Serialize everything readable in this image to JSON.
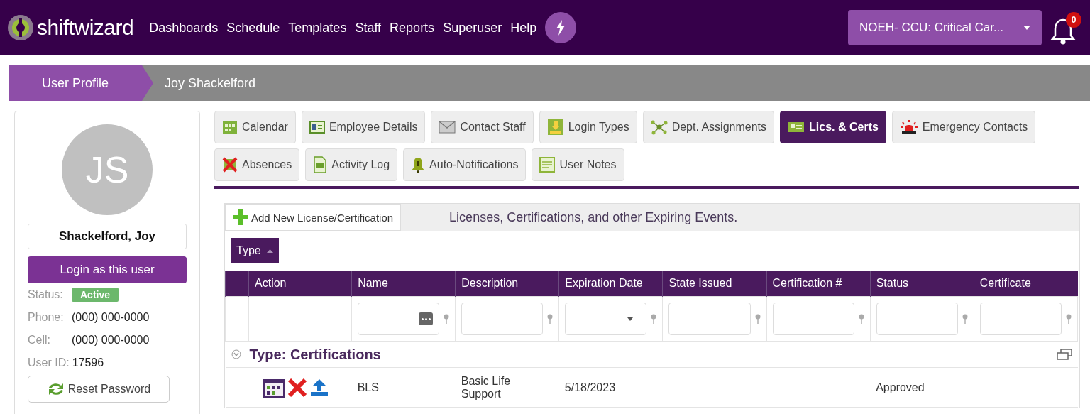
{
  "header": {
    "logo": "shiftwizard",
    "nav": [
      "Dashboards",
      "Schedule",
      "Templates",
      "Staff",
      "Reports",
      "Superuser",
      "Help"
    ],
    "department": "NOEH- CCU: Critical Car...",
    "notifications": "0"
  },
  "breadcrumb": [
    "User Profile",
    "Joy Shackelford"
  ],
  "profile": {
    "initials": "JS",
    "name": "Shackelford, Joy",
    "login_button": "Login as this user",
    "fields": [
      {
        "label": "Status:",
        "value": "Active",
        "kind": "badge"
      },
      {
        "label": "Phone:",
        "value": "(000) 000-0000",
        "kind": "text"
      },
      {
        "label": "Cell:",
        "value": "(000) 000-0000",
        "kind": "text"
      },
      {
        "label": "User ID:",
        "value": "17596",
        "kind": "text"
      }
    ],
    "reset_button": "Reset Password"
  },
  "tabs": [
    {
      "label": "Calendar",
      "selected": false
    },
    {
      "label": "Employee Details",
      "selected": false
    },
    {
      "label": "Contact Staff",
      "selected": false
    },
    {
      "label": "Login Types",
      "selected": false
    },
    {
      "label": "Dept. Assignments",
      "selected": false
    },
    {
      "label": "Lics. & Certs",
      "selected": true
    },
    {
      "label": "Emergency Contacts",
      "selected": false
    },
    {
      "label": "Absences",
      "selected": false
    },
    {
      "label": "Activity Log",
      "selected": false
    },
    {
      "label": "Auto-Notifications",
      "selected": false
    },
    {
      "label": "User Notes",
      "selected": false
    }
  ],
  "grid": {
    "add_button": "Add New License/Certification",
    "title": "Licenses, Certifications, and other Expiring Events.",
    "group_by": "Type",
    "columns": [
      {
        "label": "Action",
        "kind": "none"
      },
      {
        "label": "Name",
        "kind": "more"
      },
      {
        "label": "Description",
        "kind": "text"
      },
      {
        "label": "Expiration Date",
        "kind": "dropdown"
      },
      {
        "label": "State Issued",
        "kind": "text"
      },
      {
        "label": "Certification #",
        "kind": "text"
      },
      {
        "label": "Status",
        "kind": "text"
      },
      {
        "label": "Certificate",
        "kind": "text"
      }
    ],
    "groups": [
      {
        "title": "Type: Certifications",
        "expanded": true,
        "rows": [
          {
            "cells": [
              "BLS",
              "Basic Life Support",
              "5/18/2023",
              "",
              "",
              "Approved",
              ""
            ]
          }
        ]
      }
    ]
  }
}
